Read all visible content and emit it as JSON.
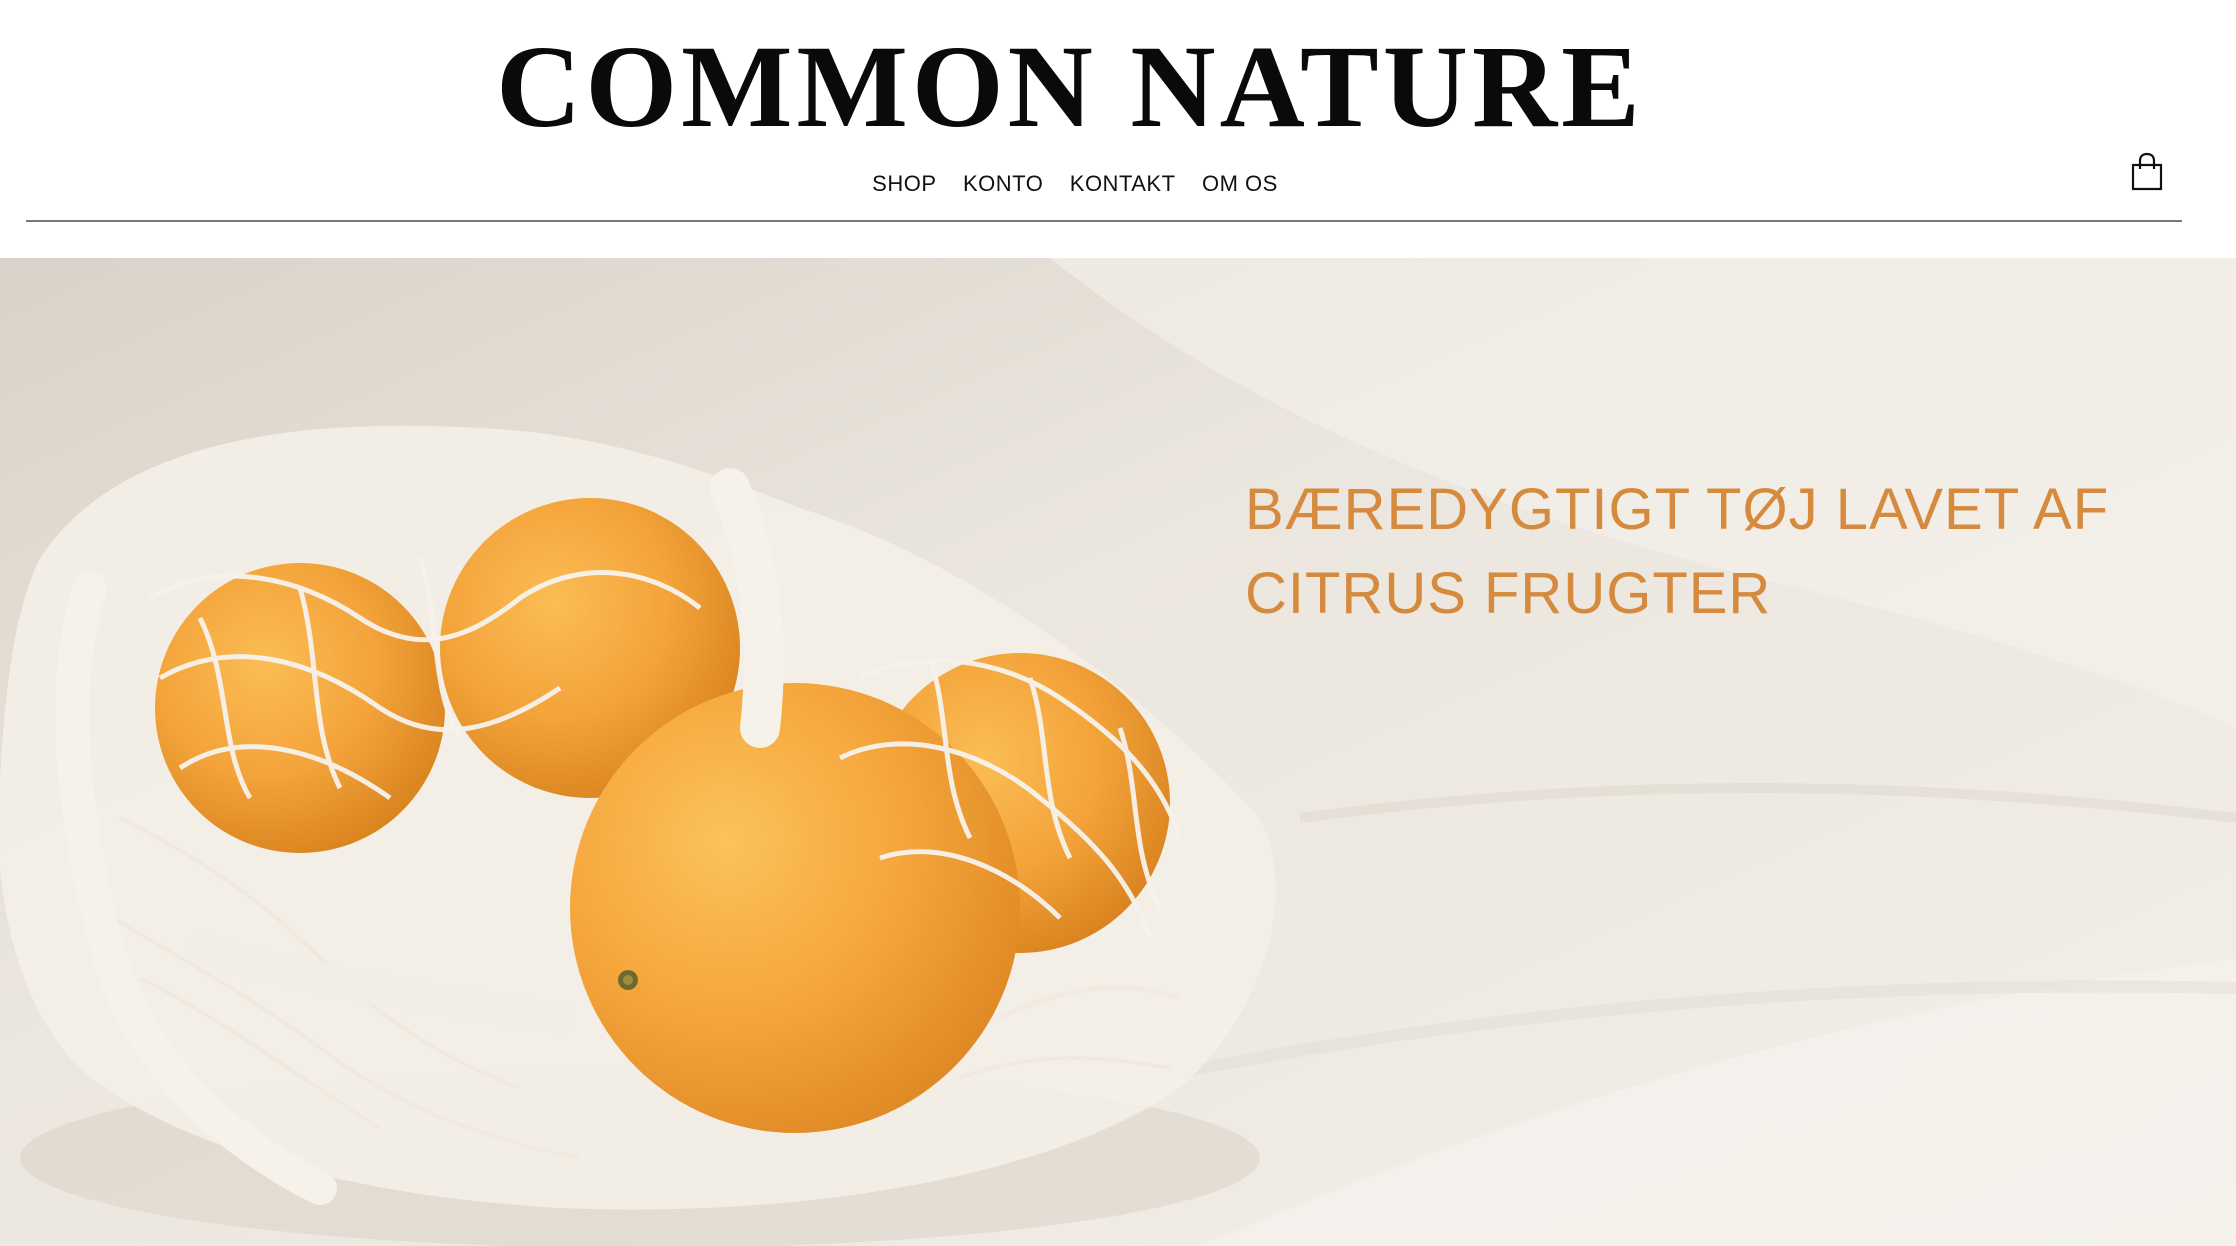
{
  "brand": {
    "logo_text": "COMMON NATURE"
  },
  "nav": {
    "items": [
      {
        "label": "SHOP"
      },
      {
        "label": "KONTO"
      },
      {
        "label": "KONTAKT"
      },
      {
        "label": "OM OS"
      }
    ]
  },
  "cart": {
    "icon": "shopping-bag-icon"
  },
  "hero": {
    "headline_line1": "BÆREDYGTIGT TØJ LAVET AF",
    "headline_line2": "CITRUS FRUGTER",
    "image": "oranges-in-mesh-bag-image"
  },
  "colors": {
    "accent": "#d68a3e",
    "orange": "#f0a135",
    "background": "#efebe4",
    "text": "#111111"
  }
}
